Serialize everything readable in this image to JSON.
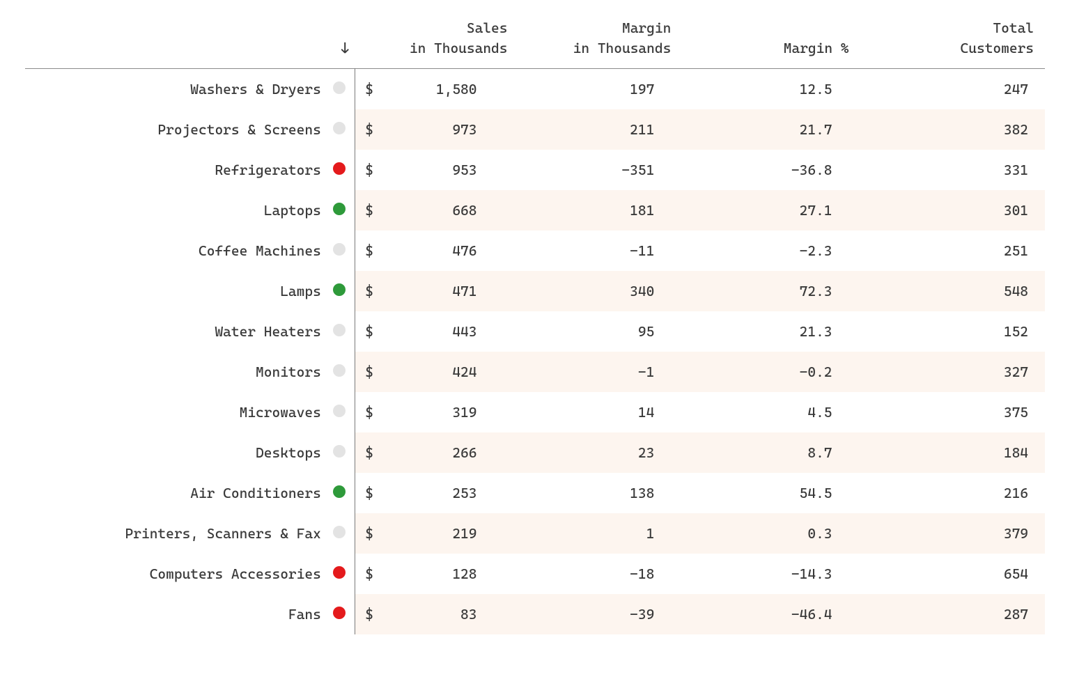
{
  "chart_data": {
    "type": "table",
    "sort_column": "Sales in Thousands",
    "sort_direction": "desc",
    "currency_symbol": "$",
    "columns": [
      {
        "key": "sales",
        "label_line1": "Sales",
        "label_line2": "in Thousands"
      },
      {
        "key": "margin",
        "label_line1": "Margin",
        "label_line2": "in Thousands"
      },
      {
        "key": "margin_pct",
        "label_line1": "Margin %",
        "label_line2": ""
      },
      {
        "key": "customers",
        "label_line1": "Total",
        "label_line2": "Customers"
      }
    ],
    "status_colors": {
      "green": "#2e9a3a",
      "red": "#e41a1c",
      "grey": "#e3e3e3"
    },
    "rows": [
      {
        "label": "Washers & Dryers",
        "status": "grey",
        "sales": "1,580",
        "margin": "197",
        "margin_pct": "12.5",
        "customers": "247"
      },
      {
        "label": "Projectors & Screens",
        "status": "grey",
        "sales": "973",
        "margin": "211",
        "margin_pct": "21.7",
        "customers": "382"
      },
      {
        "label": "Refrigerators",
        "status": "red",
        "sales": "953",
        "margin": "-351",
        "margin_pct": "-36.8",
        "customers": "331"
      },
      {
        "label": "Laptops",
        "status": "green",
        "sales": "668",
        "margin": "181",
        "margin_pct": "27.1",
        "customers": "301"
      },
      {
        "label": "Coffee Machines",
        "status": "grey",
        "sales": "476",
        "margin": "-11",
        "margin_pct": "-2.3",
        "customers": "251"
      },
      {
        "label": "Lamps",
        "status": "green",
        "sales": "471",
        "margin": "340",
        "margin_pct": "72.3",
        "customers": "548"
      },
      {
        "label": "Water Heaters",
        "status": "grey",
        "sales": "443",
        "margin": "95",
        "margin_pct": "21.3",
        "customers": "152"
      },
      {
        "label": "Monitors",
        "status": "grey",
        "sales": "424",
        "margin": "-1",
        "margin_pct": "-0.2",
        "customers": "327"
      },
      {
        "label": "Microwaves",
        "status": "grey",
        "sales": "319",
        "margin": "14",
        "margin_pct": "4.5",
        "customers": "375"
      },
      {
        "label": "Desktops",
        "status": "grey",
        "sales": "266",
        "margin": "23",
        "margin_pct": "8.7",
        "customers": "184"
      },
      {
        "label": "Air Conditioners",
        "status": "green",
        "sales": "253",
        "margin": "138",
        "margin_pct": "54.5",
        "customers": "216"
      },
      {
        "label": "Printers, Scanners & Fax",
        "status": "grey",
        "sales": "219",
        "margin": "1",
        "margin_pct": "0.3",
        "customers": "379"
      },
      {
        "label": "Computers Accessories",
        "status": "red",
        "sales": "128",
        "margin": "-18",
        "margin_pct": "-14.3",
        "customers": "654"
      },
      {
        "label": "Fans",
        "status": "red",
        "sales": "83",
        "margin": "-39",
        "margin_pct": "-46.4",
        "customers": "287"
      }
    ]
  }
}
